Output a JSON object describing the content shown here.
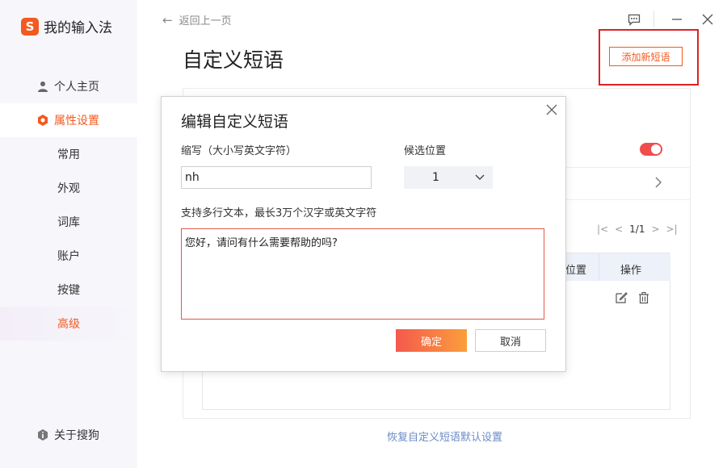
{
  "app": {
    "name": "我的输入法",
    "logo_letter": "S",
    "brand_color": "#f25a1f"
  },
  "sidebar": {
    "items": [
      {
        "label": "个人主页",
        "icon": "user-icon"
      },
      {
        "label": "属性设置",
        "icon": "gear-hex-icon"
      },
      {
        "label": "常用"
      },
      {
        "label": "外观"
      },
      {
        "label": "词库"
      },
      {
        "label": "账户"
      },
      {
        "label": "按键"
      },
      {
        "label": "高级"
      }
    ],
    "about": {
      "label": "关于搜狗",
      "icon": "info-shield-icon"
    }
  },
  "header": {
    "back_label": "返回上一页",
    "title": "自定义短语",
    "add_button": "添加新短语"
  },
  "window_controls": {
    "feedback": "feedback-icon",
    "minimize": "minimize-icon",
    "close": "close-icon"
  },
  "panel": {
    "pager": {
      "first": "|<",
      "prev": "<",
      "page": "1/1",
      "next": ">",
      "last": ">|"
    },
    "table": {
      "headers": [
        "位置",
        "操作"
      ]
    },
    "row_actions": [
      "edit-icon",
      "trash-icon"
    ]
  },
  "footer": {
    "reset_link": "恢复自定义短语默认设置"
  },
  "dialog": {
    "title": "编辑自定义短语",
    "abbr_label": "缩写（大小写英文字符）",
    "abbr_value": "nh",
    "position_label": "候选位置",
    "position_value": "1",
    "hint": "支持多行文本，最长3万个汉字或英文字符",
    "content_value": "您好，请问有什么需要帮助的吗?",
    "ok_label": "确定",
    "cancel_label": "取消"
  }
}
